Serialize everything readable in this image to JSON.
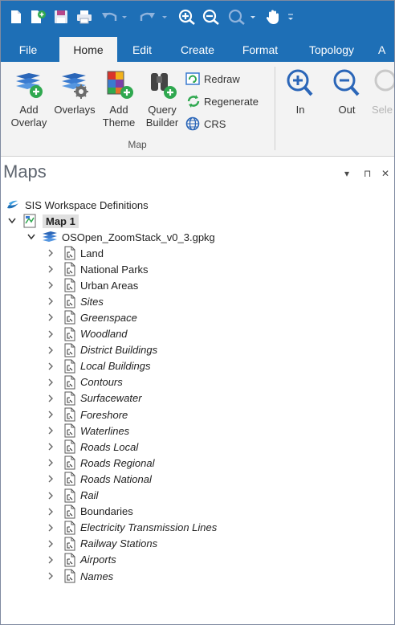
{
  "colors": {
    "ribbon_blue": "#1e6fb6",
    "ribbon_bg": "#f3f3f3",
    "panel_title": "#5f6670"
  },
  "quick_access": [
    {
      "icon": "new-document-icon"
    },
    {
      "icon": "open-icon"
    },
    {
      "icon": "save-icon"
    },
    {
      "icon": "print-icon"
    },
    {
      "icon": "undo-icon"
    },
    {
      "icon": "redo-icon"
    },
    {
      "icon": "zoom-in-icon"
    },
    {
      "icon": "zoom-out-icon"
    },
    {
      "icon": "zoom-icon"
    },
    {
      "icon": "pan-hand-icon"
    },
    {
      "icon": "customize-toolbar-icon"
    }
  ],
  "tabs": [
    "File",
    "Home",
    "Edit",
    "Create",
    "Format",
    "Topology",
    "A"
  ],
  "active_tab": "Home",
  "ribbon": {
    "add_overlay": {
      "line1": "Add",
      "line2": "Overlay"
    },
    "overlays": {
      "line1": "Overlays"
    },
    "add_theme": {
      "line1": "Add",
      "line2": "Theme"
    },
    "query_builder": {
      "line1": "Query",
      "line2": "Builder"
    },
    "redraw": "Redraw",
    "regenerate": "Regenerate",
    "crs": "CRS",
    "group_label": "Map",
    "zoom_in": "In",
    "zoom_out": "Out",
    "select": "Sele"
  },
  "panel": {
    "title": "Maps",
    "dropdown_glyph": "▾",
    "pin_glyph": "⊓",
    "close_glyph": "✕"
  },
  "tree": {
    "root": "SIS Workspace Definitions",
    "map": "Map 1",
    "dataset": "OSOpen_ZoomStack_v0_3.gpkg",
    "layers": [
      {
        "name": "Land",
        "italic": false
      },
      {
        "name": "National Parks",
        "italic": false
      },
      {
        "name": "Urban Areas",
        "italic": false
      },
      {
        "name": "Sites",
        "italic": true
      },
      {
        "name": "Greenspace",
        "italic": true
      },
      {
        "name": "Woodland",
        "italic": true
      },
      {
        "name": "District Buildings",
        "italic": true
      },
      {
        "name": "Local Buildings",
        "italic": true
      },
      {
        "name": "Contours",
        "italic": true
      },
      {
        "name": "Surfacewater",
        "italic": true
      },
      {
        "name": "Foreshore",
        "italic": true
      },
      {
        "name": "Waterlines",
        "italic": true
      },
      {
        "name": "Roads Local",
        "italic": true
      },
      {
        "name": "Roads Regional",
        "italic": true
      },
      {
        "name": "Roads National",
        "italic": true
      },
      {
        "name": "Rail",
        "italic": true
      },
      {
        "name": "Boundaries",
        "italic": false
      },
      {
        "name": "Electricity Transmission Lines",
        "italic": true
      },
      {
        "name": "Railway Stations",
        "italic": true
      },
      {
        "name": "Airports",
        "italic": true
      },
      {
        "name": "Names",
        "italic": true
      }
    ]
  }
}
